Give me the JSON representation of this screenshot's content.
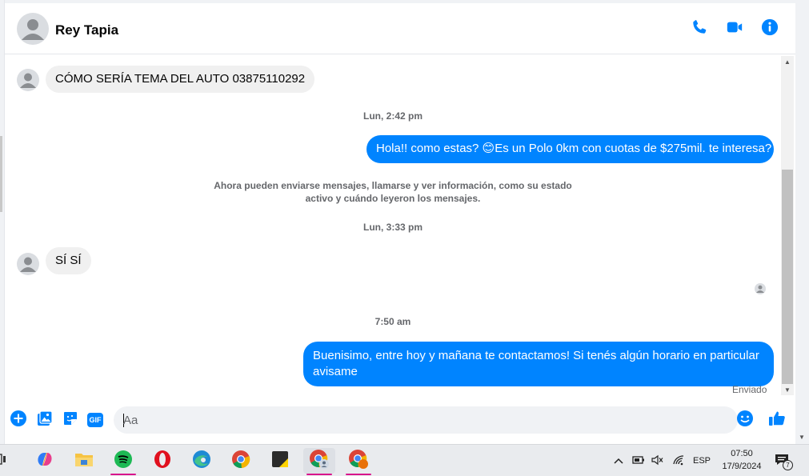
{
  "contact": {
    "name": "Rey Tapia"
  },
  "header_actions": [
    "phone-icon",
    "video-icon",
    "info-icon"
  ],
  "messages": [
    {
      "type": "in",
      "text": "CÓMO SERÍA TEMA DEL AUTO 03875110292"
    },
    {
      "type": "timestamp",
      "text": "Lun, 2:42 pm"
    },
    {
      "type": "out",
      "text": "Hola!! como estas? 😊Es un Polo 0km con cuotas de $275mil. te interesa?"
    },
    {
      "type": "notice",
      "line1": "Ahora pueden enviarse mensajes, llamarse y ver información, como su estado",
      "line2": "activo y cuándo leyeron los mensajes."
    },
    {
      "type": "timestamp",
      "text": "Lun, 3:33 pm"
    },
    {
      "type": "in",
      "text": "SÍ SÍ"
    },
    {
      "type": "timestamp",
      "text": "7:50 am"
    },
    {
      "type": "out",
      "text": "Buenisimo, entre hoy y mañana te contactamos! Si tenés algún horario en particular avisame"
    }
  ],
  "status": {
    "sent": "Enviado"
  },
  "composer": {
    "placeholder": "Aa",
    "value": "",
    "tools": [
      "plus-icon",
      "image-icon",
      "sticker-icon",
      "gif-icon"
    ],
    "gif_label": "GIF"
  },
  "colors": {
    "accent": "#0084ff",
    "bubble_in": "#f0f0f0",
    "text_secondary": "#65676b"
  },
  "taskbar": {
    "apps": [
      "task-view",
      "copilot",
      "file-explorer",
      "spotify",
      "opera",
      "edge",
      "chrome",
      "sticky-notes",
      "chrome-profile",
      "chrome-profile-2"
    ],
    "tray": {
      "language": "ESP",
      "time": "07:50",
      "date": "17/9/2024",
      "notification_count": "7"
    }
  }
}
